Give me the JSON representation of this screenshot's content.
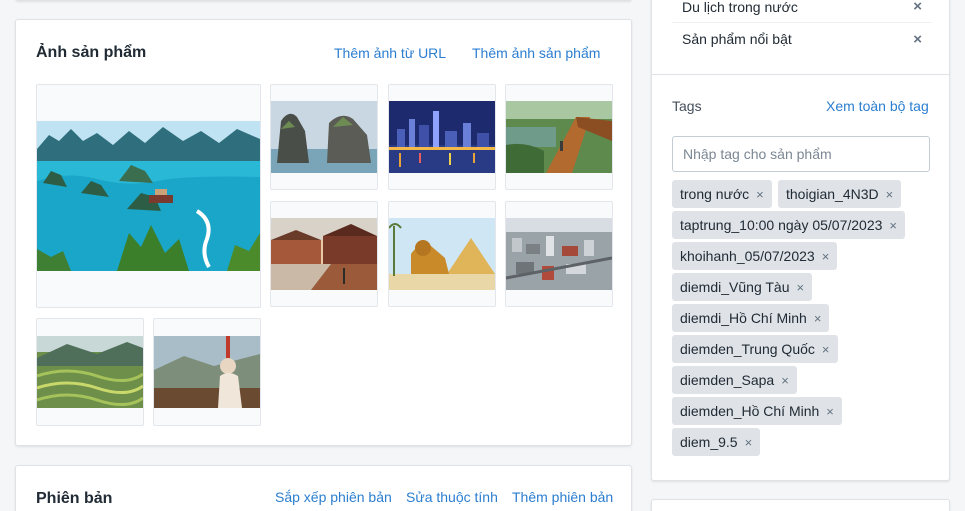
{
  "images_section": {
    "title": "Ảnh sản phẩm",
    "add_from_url": "Thêm ảnh từ URL",
    "add_image": "Thêm ảnh sản phẩm"
  },
  "variants_section": {
    "title": "Phiên bản",
    "sort_variants": "Sắp xếp phiên bản",
    "edit_attributes": "Sửa thuộc tính",
    "add_variant": "Thêm phiên bản"
  },
  "categories": [
    {
      "label": "Du lịch trong nước"
    },
    {
      "label": "Sản phẩm nổi bật"
    }
  ],
  "tags_section": {
    "label": "Tags",
    "view_all": "Xem toàn bộ tag",
    "input_placeholder": "Nhập tag cho sản phẩm",
    "remove_symbol": "×",
    "tags": [
      "trong nước",
      "thoigian_4N3D",
      "taptrung_10:00 ngày 05/07/2023",
      "khoihanh_05/07/2023",
      "diemdi_Vũng Tàu",
      "diemdi_Hồ Chí Minh",
      "diemden_Trung Quốc",
      "diemden_Sapa",
      "diemden_Hồ Chí Minh",
      "diem_9.5"
    ]
  }
}
